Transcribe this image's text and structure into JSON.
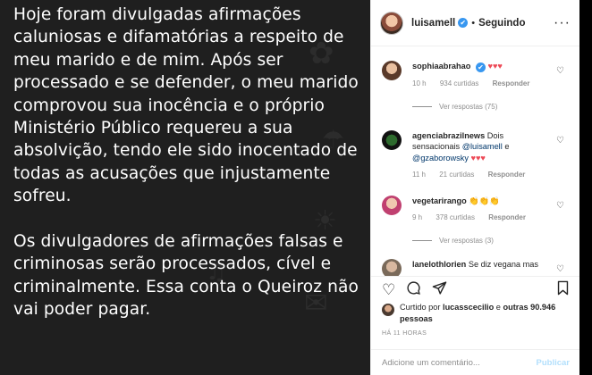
{
  "story": {
    "paragraphs": [
      "Hoje foram divulgadas afirmações caluniosas e difamatórias a respeito de meu marido e de mim. Após ser processado e se defender, o meu marido comprovou sua inocência e o próprio Ministério Público requereu a sua absolvição, tendo ele sido inocentado de todas as acusações que injustamente sofreu.",
      "Os divulgadores de afirmações falsas e criminosas serão processados, cível e criminalmente. Essa conta o Queiroz não vai poder pagar."
    ],
    "background_color": "#1f1f1f"
  },
  "header": {
    "username": "luisamell",
    "verified_icon": "✔",
    "separator": "•",
    "follow_status": "Seguindo",
    "more_icon": "more-dots-icon"
  },
  "comments": [
    {
      "username": "sophiaabrahao",
      "text": "",
      "emoji": "♥♥♥",
      "time": "10 h",
      "likes": "934 curtidas",
      "reply": "Responder",
      "view_replies": "Ver respostas (75)"
    },
    {
      "username": "agenciabrazilnews",
      "text_before": "Dois sensacionais",
      "mention1": "@luisamell",
      "conj": "e",
      "mention2": "@gzaborowsky",
      "emoji": "♥♥♥",
      "time": "11 h",
      "likes": "21 curtidas",
      "reply": "Responder"
    },
    {
      "username": "vegetarirango",
      "emoji": "👏👏👏",
      "time": "9 h",
      "likes": "378 curtidas",
      "reply": "Responder",
      "view_replies": "Ver respostas (3)"
    },
    {
      "username": "lanelothlorien",
      "text": "Se diz vegana mas"
    }
  ],
  "actions": {
    "like_icon": "heart-outline-icon",
    "comment_icon": "comment-icon",
    "share_icon": "share-icon",
    "save_icon": "bookmark-icon"
  },
  "likes_summary": {
    "prefix": "Curtido por",
    "user": "lucasscecilio",
    "middle": "e",
    "others": "outras 90.946 pessoas"
  },
  "timestamp": "HÁ 11 HORAS",
  "comment_box": {
    "placeholder": "Adicione um comentário...",
    "publish": "Publicar"
  },
  "colors": {
    "verified": "#3897f0",
    "heart_red": "#ed4956",
    "publish_disabled": "#b2dffc",
    "mention": "#00376b",
    "secondary_text": "#8e8e8e"
  }
}
